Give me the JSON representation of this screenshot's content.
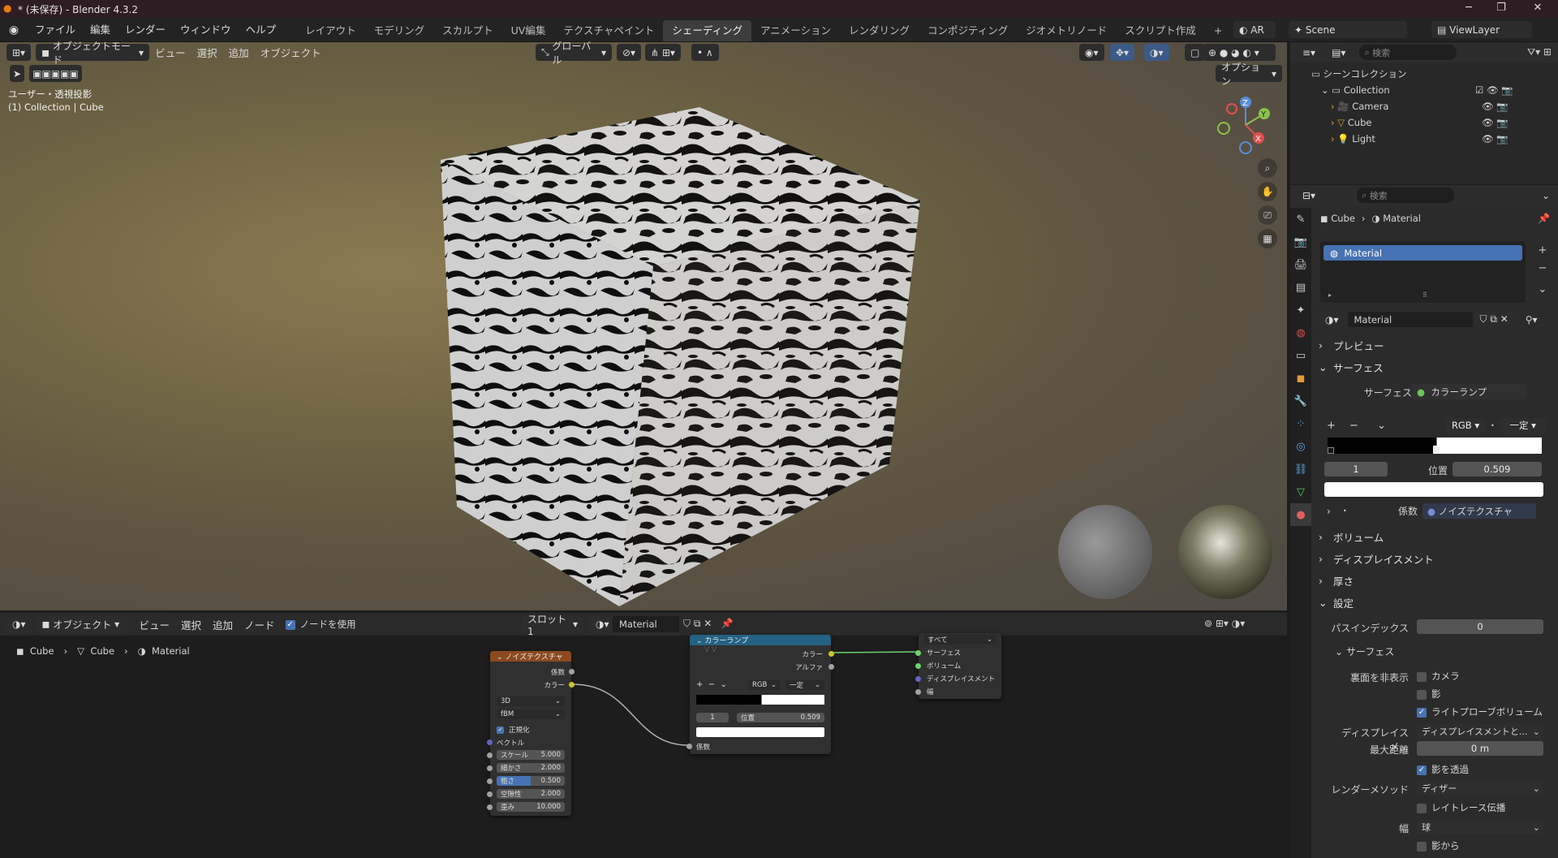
{
  "window": {
    "title": "* (未保存) - Blender 4.3.2"
  },
  "menu": [
    "ファイル",
    "編集",
    "レンダー",
    "ウィンドウ",
    "ヘルプ"
  ],
  "workspaces": [
    "レイアウト",
    "モデリング",
    "スカルプト",
    "UV編集",
    "テクスチャペイント",
    "シェーディング",
    "アニメーション",
    "レンダリング",
    "コンポジティング",
    "ジオメトリノード",
    "スクリプト作成"
  ],
  "active_workspace": "シェーディング",
  "top_right": {
    "ar": "AR",
    "scene": "Scene",
    "view_layer": "ViewLayer"
  },
  "viewport": {
    "mode": "オブジェクトモード",
    "menus": [
      "ビュー",
      "選択",
      "追加",
      "オブジェクト"
    ],
    "transform": "グローバル",
    "options": "オプション",
    "info_line1": "ユーザー・透視投影",
    "info_line2": "(1) Collection | Cube",
    "gizmo": {
      "z": "Z",
      "y": "Y",
      "x": "X"
    }
  },
  "outliner": {
    "search_placeholder": "検索",
    "root": "シーンコレクション",
    "collection": "Collection",
    "items": [
      "Camera",
      "Cube",
      "Light"
    ]
  },
  "properties": {
    "search_placeholder": "検索",
    "breadcrumb": [
      "Cube",
      "Material"
    ],
    "slot": "Material",
    "material_name": "Material",
    "sections": {
      "preview": "プレビュー",
      "surface": "サーフェス",
      "volume": "ボリューム",
      "displacement": "ディスプレイスメント",
      "thickness": "厚さ",
      "settings": "設定"
    },
    "surface_label": "サーフェス",
    "surface_value": "カラーランプ",
    "ramp_mode": "RGB",
    "ramp_interp": "一定",
    "stop_index": "1",
    "position_label": "位置",
    "position_value": "0.509",
    "factor_label": "係数",
    "factor_value": "ノイズテクスチャ",
    "pass_index_label": "パスインデックス",
    "pass_index_value": "0",
    "sub_surface": "サーフェス",
    "backface_label": "裏面を非表示",
    "backface_camera": "カメラ",
    "backface_shadow": "影",
    "light_probe": "ライトプローブボリューム",
    "disp_label": "ディスプレイスメ...",
    "disp_value": "ディスプレイスメントと...",
    "max_dist_label": "最大距離",
    "max_dist_value": "0 m",
    "transparent_shadow": "影を透過",
    "render_method_label": "レンダーメソッド",
    "render_method_value": "ディザー",
    "raytrace": "レイトレース伝播",
    "width_label": "幅",
    "width_value": "球",
    "from_shadow": "影から"
  },
  "node_editor": {
    "mode": "オブジェクト",
    "menus": [
      "ビュー",
      "選択",
      "追加",
      "ノード"
    ],
    "use_nodes": "ノードを使用",
    "slot": "スロット1",
    "material": "Material",
    "breadcrumb": [
      "Cube",
      "Cube",
      "Material"
    ],
    "noise": {
      "title": "ノイズテクスチャ",
      "out_fac": "係数",
      "out_color": "カラー",
      "dim": "3D",
      "type": "fBM",
      "normalize": "正規化",
      "vector": "ベクトル",
      "fields": [
        {
          "label": "スケール",
          "value": "5.000"
        },
        {
          "label": "細かさ",
          "value": "2.000"
        },
        {
          "label": "粗さ",
          "value": "0.500"
        },
        {
          "label": "空隙性",
          "value": "2.000"
        },
        {
          "label": "歪み",
          "value": "10.000"
        }
      ]
    },
    "ramp": {
      "title": "カラーランプ",
      "out_color": "カラー",
      "out_alpha": "アルファ",
      "mode": "RGB",
      "interp": "一定",
      "index": "1",
      "pos_label": "位置",
      "pos_value": "0.509",
      "in_fac": "係数"
    },
    "output": {
      "target": "すべて",
      "inputs": [
        "サーフェス",
        "ボリューム",
        "ディスプレイスメント",
        "幅"
      ]
    }
  },
  "colors": {
    "accent": "#4772b3",
    "noise_header": "#8c4a1f",
    "ramp_header": "#246283",
    "title_bg": "#2f1d24"
  }
}
